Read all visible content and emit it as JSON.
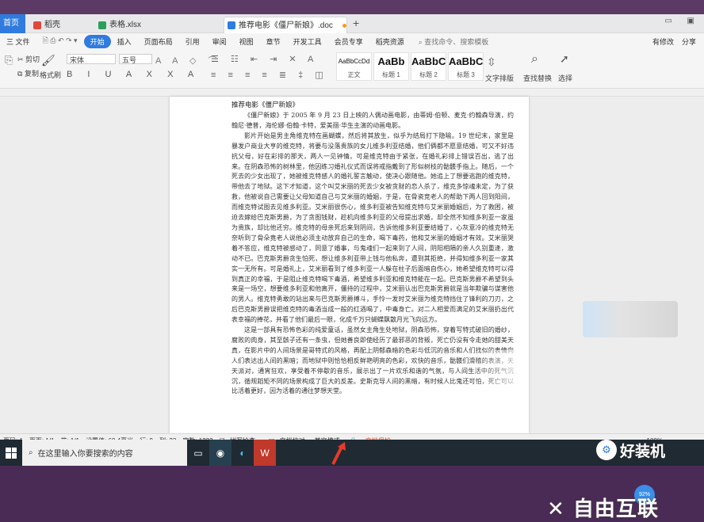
{
  "tabs": {
    "home": "首页",
    "t1": "稻壳",
    "t2": "表格.xlsx",
    "t3": "推荐电影《僵尸新娘》.doc"
  },
  "menu": {
    "file": "三 文件",
    "items": [
      "开始",
      "插入",
      "页面布局",
      "引用",
      "审阅",
      "视图",
      "章节",
      "开发工具",
      "会员专享",
      "稻壳资源"
    ],
    "search": "查找命令、搜索模板",
    "right1": "有修改",
    "right2": "分享"
  },
  "ribbon": {
    "cut": "剪切",
    "copy": "复制",
    "format_painter": "格式刷",
    "font": "宋体",
    "size": "五号",
    "styles": [
      {
        "big": "AaBbCcDd",
        "small": "正文"
      },
      {
        "big": "AaBb",
        "small": "标题 1"
      },
      {
        "big": "AaBbC",
        "small": "标题 2"
      },
      {
        "big": "AaBbCc",
        "small": "标题 3"
      }
    ],
    "text_layout": "文字排版",
    "find_replace": "查找替换",
    "select": "选择"
  },
  "document": {
    "title": "推荐电影《僵尸新娘》",
    "paragraphs": [
      "《僵尸新娘》于 2005 年 9 月 23 日上映的人偶动画电影，由蒂姆·伯顿、麦克·约翰森导演，约翰尼·德普，海伦娜·伯翰·卡特，爱美丽·华生主演的动画电影。",
      "影片开始是男主角维克特在画蝴蝶，然后将其放生，似乎为结局打下隐喻。19 世纪末，家里是暴发户商业大亨的维克特，将要与没落贵族的女儿维多利亚结婚，他们俩都不愿意结婚，可又不好违抗父母，好在彩排的那天，两人一见钟情。可是维克特由于紧张，在婚礼彩排上错误百出，逃了出来。在阴森恐怖的树林里，他因练习婚礼仪式而误将戒指戴到了形似树枝的骷髅手指上。随后，一个死去的少女出现了，她被维克特感人的婚礼誓言触动，使决心跟随他。她追上了想要逃跑的维克特，带他去了地狱。这下才知道，这个叫艾米丽的死去少女被贪财的恋人杀了，维克多惊魂未定，为了获救，他被说自己需要让父母知道自己与艾米丽的婚姻，于是，在骨瓷竞老人的帮助下两人回到阳间，而维克特试图去见维多利亚。艾米丽很伤心，维多利亚被告知维克特与艾米丽婚姻后，为了救困，被迫去嫁给巴克斯男爵，为了贪图钱财，趁机向维多利亚的父母提出求婚，却全然不知维多利亚一家虽为贵族，却比他还穷。维克特的母亲死后来到阴间，告诉他维多利亚要结婚了，心灰意冷的维克特无奈听到了骨朵竟老人说他必须主动放弃自己的生命，喝下毒药，他和艾米丽的婚姻才有效。艾米丽哭着不答应，维克特被感动了，同意了婚事，与鬼魂们一起来到了人间，阴阳相隔的亲人久别重逢，激动不已。巴克斯男爵贪生怕死，想让维多利亚带上钱与他私奔，遭到其拒绝，并得知维多利亚一家其实一无所有。可是婚礼上，艾米丽看到了维多利亚一人躲在柱子后面暗自伤心，她希望维克特可以得到真正的幸福，于是阻止维克特喝下毒酒，希望维多利亚和维克特能在一起。巴克斯男爵不希望到头来是一场空，想要维多利亚和他离开，僵持的过程中，艾米丽认出巴克斯男爵就是当年欺骗与谋害他的男人。维克特勇敢的站出来与巴克斯男爵搏斗，手怜一发时艾米丽为维克特挡住了锋利的刀刃，之后巴克斯男爵误把维克特的毒酒当成一般的红酒喝了，中毒身亡。对二人相爱而满足的艾米丽扔出代表幸福的捧花，并看了他们最后一眼，化成千万只蝴蝶飘散月光飞向远方。",
      "这是一部具有恐怖色彩的纯爱童话，虽然女主角生处地狱，阴森恐怖，穿着写特式破旧的婚纱，腐败的肉身，其至骸子还有一条虫，但她善良即使经历了最邪恶的背叛，死亡仍没有令走她的甜美天真，在影片中的人间场景是哥特式的风格，再配上阴郁森暗的色彩与低沉的音乐和人们找似的表情向人们表达出人间的黑暗；而地狱中则恰恰相反鲜艳明亮的色彩，欢快的音乐，骷髅们滑稽的表演，天天派对，通宵狂欢，享受着不停歇的音乐，展示出了一片欢乐和谐的气氛，与人间生活中的死气沉沉，循规蹈矩不同的场景构成了巨大的反差。史斯克导人间的黑暗，有时候人比鬼还可怕，死亡可以比活着更好，因为活着的通往梦想天堂。"
    ]
  },
  "status": {
    "page": "页码: 1",
    "pages": "页面: 1/1",
    "section": "节: 1/1",
    "position": "设置值: 69.4毫米",
    "row": "行: 9",
    "col": "列: 23",
    "words": "字数: 1223",
    "spell": "拼写检查 ·",
    "doc_check": "文档校对",
    "compat": "兼容模式",
    "protect": "文档保护",
    "zoom": "100%"
  },
  "watermark": "自由互联",
  "brand": "好装机",
  "bubble": "92%",
  "taskbar": {
    "search_placeholder": "在这里输入你要搜索的内容"
  },
  "colors": {
    "accent": "#2f7be0",
    "highlight": "#e54a2a"
  }
}
